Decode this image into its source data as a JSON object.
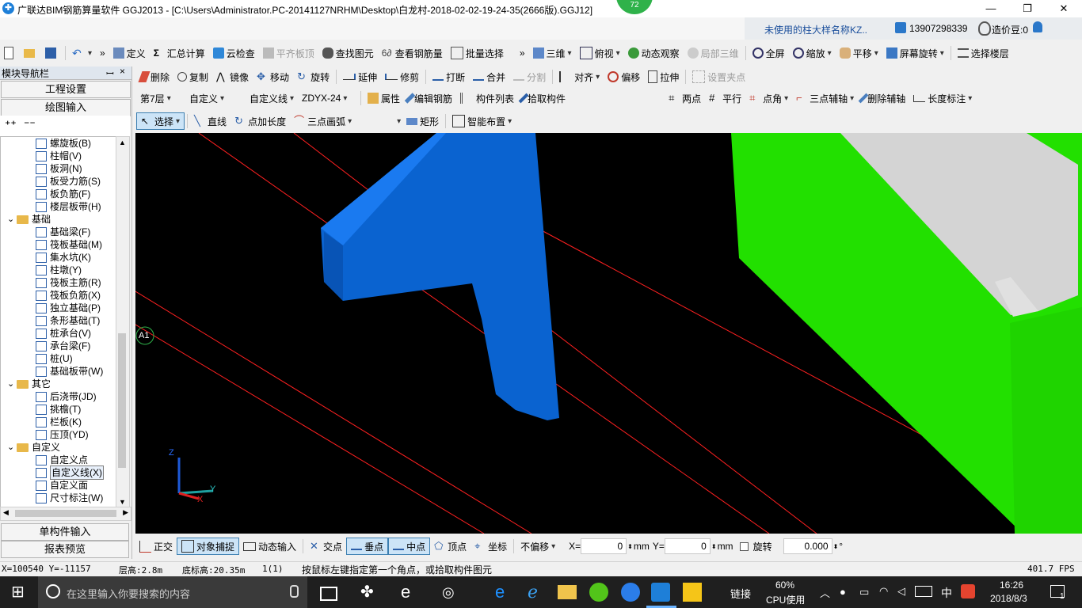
{
  "window": {
    "title": "广联达BIM钢筋算量软件 GGJ2013 - [C:\\Users\\Administrator.PC-20141127NRHM\\Desktop\\白龙村-2018-02-02-19-24-35(2666版).GGJ12]",
    "badge": "72",
    "minimize": "—",
    "maximize": "❐",
    "close": "✕"
  },
  "info": {
    "notice": "未使用的柱大样名称KZ..",
    "phone": "13907298339",
    "beans": "造价豆:0"
  },
  "toolbar1": {
    "define": "定义",
    "sum": "汇总计算",
    "cloudcheck": "云检查",
    "align_slab_top": "平齐板顶",
    "find_element": "查找图元",
    "view_rebar": "查看钢筋量",
    "batch_select": "批量选择",
    "view3d": "三维",
    "top_view": "俯视",
    "dyn_observe": "动态观察",
    "local3d": "局部三维",
    "fullscreen": "全屏",
    "zoom": "缩放",
    "pan": "平移",
    "rotate_screen": "屏幕旋转",
    "select_floor": "选择楼层"
  },
  "toolbar2": {
    "delete": "删除",
    "copy": "复制",
    "mirror": "镜像",
    "move": "移动",
    "rotate": "旋转",
    "extend": "延伸",
    "trim": "修剪",
    "break": "打断",
    "merge": "合并",
    "split": "分割",
    "align": "对齐",
    "offset": "偏移",
    "stretch": "拉伸",
    "set_grip": "设置夹点"
  },
  "toolbar3": {
    "floor": "第7层",
    "category": "自定义",
    "type": "自定义线",
    "name": "ZDYX-24",
    "properties": "属性",
    "edit_rebar": "编辑钢筋",
    "component_list": "构件列表",
    "pick_component": "拾取构件",
    "two_point": "两点",
    "parallel": "平行",
    "point_angle": "点角",
    "three_point_axis": "三点辅轴",
    "delete_axis": "删除辅轴",
    "length_mark": "长度标注"
  },
  "toolbar4": {
    "select": "选择",
    "line": "直线",
    "point_length": "点加长度",
    "three_point_arc": "三点画弧",
    "rect": "矩形",
    "smart_place": "智能布置"
  },
  "leftpanel": {
    "header": "模块导航栏",
    "pin": "ꟷ",
    "close": "×",
    "eng_settings": "工程设置",
    "draw_input": "绘图输入",
    "single_input": "单构件输入",
    "report_preview": "报表预览",
    "tree": [
      {
        "label": "螺旋板(B)",
        "level": 2
      },
      {
        "label": "柱帽(V)",
        "level": 2
      },
      {
        "label": "板洞(N)",
        "level": 2
      },
      {
        "label": "板受力筋(S)",
        "level": 2
      },
      {
        "label": "板负筋(F)",
        "level": 2
      },
      {
        "label": "楼层板带(H)",
        "level": 2
      },
      {
        "label": "基础",
        "level": 1
      },
      {
        "label": "基础梁(F)",
        "level": 2
      },
      {
        "label": "筏板基础(M)",
        "level": 2
      },
      {
        "label": "集水坑(K)",
        "level": 2
      },
      {
        "label": "柱墩(Y)",
        "level": 2
      },
      {
        "label": "筏板主筋(R)",
        "level": 2
      },
      {
        "label": "筏板负筋(X)",
        "level": 2
      },
      {
        "label": "独立基础(P)",
        "level": 2
      },
      {
        "label": "条形基础(T)",
        "level": 2
      },
      {
        "label": "桩承台(V)",
        "level": 2
      },
      {
        "label": "承台梁(F)",
        "level": 2
      },
      {
        "label": "桩(U)",
        "level": 2
      },
      {
        "label": "基础板带(W)",
        "level": 2
      },
      {
        "label": "其它",
        "level": 1
      },
      {
        "label": "后浇带(JD)",
        "level": 2
      },
      {
        "label": "挑檐(T)",
        "level": 2
      },
      {
        "label": "栏板(K)",
        "level": 2
      },
      {
        "label": "压顶(YD)",
        "level": 2
      },
      {
        "label": "自定义",
        "level": 1
      },
      {
        "label": "自定义点",
        "level": 2
      },
      {
        "label": "自定义线(X)",
        "level": 2
      },
      {
        "label": "自定义面",
        "level": 2
      },
      {
        "label": "尺寸标注(W)",
        "level": 2
      }
    ]
  },
  "canvas": {
    "axis_label": "A1",
    "axis_x": "X",
    "axis_y": "Y",
    "axis_z": "Z",
    "colors": {
      "background": "#000000",
      "blue": "#0a63d0",
      "green": "#22e000",
      "gray": "#d0d0d0",
      "redline": "#ff2020"
    }
  },
  "snapbar": {
    "ortho": "正交",
    "object_snap": "对象捕捉",
    "dynamic_input": "动态输入",
    "intersect": "交点",
    "perpendicular": "垂点",
    "midpoint": "中点",
    "vertex": "顶点",
    "coordinate": "坐标",
    "offset_mode": "不偏移",
    "x_label": "X=",
    "x_value": "0",
    "y_label": "Y=",
    "y_value": "0",
    "unit": "mm",
    "rotate": "旋转",
    "rotate_value": "0.000",
    "degree": "°"
  },
  "status": {
    "coords": "X=100540  Y=-11157",
    "floor_height": "层高:2.8m",
    "base_height": "底标高:20.35m",
    "count": "1(1)",
    "hint": "按鼠标左键指定第一个角点，或拾取构件图元",
    "fps": "401.7 FPS"
  },
  "taskbar": {
    "search_placeholder": "在这里输入你要搜索的内容",
    "link": "链接",
    "cpu_pct": "60%",
    "cpu_label": "CPU使用",
    "ime": "中",
    "time": "16:26",
    "date": "2018/8/3",
    "notif": "1"
  }
}
